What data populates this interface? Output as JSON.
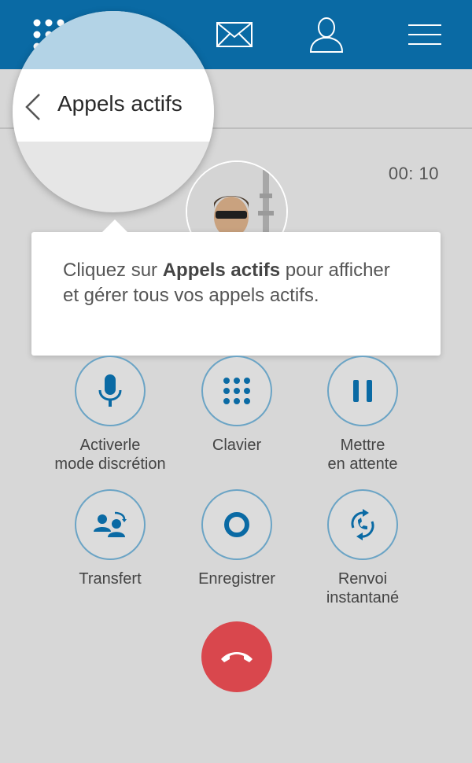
{
  "nav": {
    "items": [
      {
        "icon": "dialpad-icon"
      },
      {
        "icon": "history-icon"
      },
      {
        "icon": "mail-icon"
      },
      {
        "icon": "contacts-icon"
      },
      {
        "icon": "menu-icon"
      }
    ]
  },
  "header": {
    "title": "Appels actifs",
    "back_icon": "chevron-left-icon"
  },
  "call": {
    "timer": "00: 10"
  },
  "tooltip": {
    "text_before": "Cliquez sur ",
    "text_bold": "Appels actifs",
    "text_after": " pour afficher et gérer tous vos appels actifs."
  },
  "actions": [
    {
      "label": "Activerle\nmode discrétion",
      "icon": "microphone-icon"
    },
    {
      "label": "Clavier",
      "icon": "keypad-icon"
    },
    {
      "label": "Mettre\nen attente",
      "icon": "pause-icon"
    },
    {
      "label": "Transfert",
      "icon": "transfer-icon"
    },
    {
      "label": "Enregistrer",
      "icon": "record-icon"
    },
    {
      "label": "Renvoi\ninstantané",
      "icon": "forward-call-icon"
    }
  ],
  "hangup": {
    "icon": "hangup-icon"
  },
  "colors": {
    "topbar": "#0a6aa4",
    "accent": "#0a6aa4",
    "ring": "#6ba4c5",
    "hangup": "#d9474d",
    "background": "#d7d7d7"
  }
}
